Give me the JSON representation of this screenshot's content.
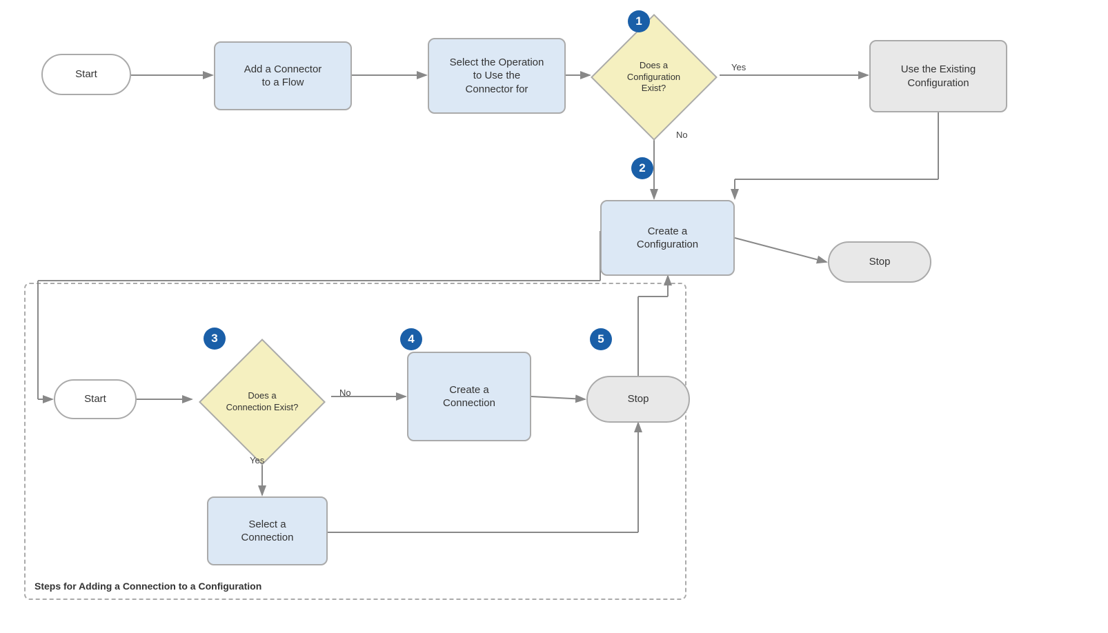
{
  "nodes": {
    "start1": {
      "label": "Start"
    },
    "addConnector": {
      "label": "Add a Connector\nto a Flow"
    },
    "selectOp": {
      "label": "Select the Operation\nto Use the\nConnector for"
    },
    "configExist": {
      "label": "Does a\nConfiguration\nExist?"
    },
    "useExisting": {
      "label": "Use the Existing\nConfiguration"
    },
    "createConfig": {
      "label": "Create a\nConfiguration"
    },
    "stopTop": {
      "label": "Stop"
    },
    "start2": {
      "label": "Start"
    },
    "connExist": {
      "label": "Does a\nConnection Exist?"
    },
    "createConn": {
      "label": "Create a\nConnection"
    },
    "stopBottom": {
      "label": "Stop"
    },
    "selectConn": {
      "label": "Select a\nConnection"
    }
  },
  "badges": {
    "b1": "1",
    "b2": "2",
    "b3": "3",
    "b4": "4",
    "b5": "5"
  },
  "labels": {
    "yes1": "Yes",
    "no1": "No",
    "no2": "No",
    "yes2": "Yes",
    "dashedBox": "Steps for Adding a Connection to a Configuration"
  }
}
